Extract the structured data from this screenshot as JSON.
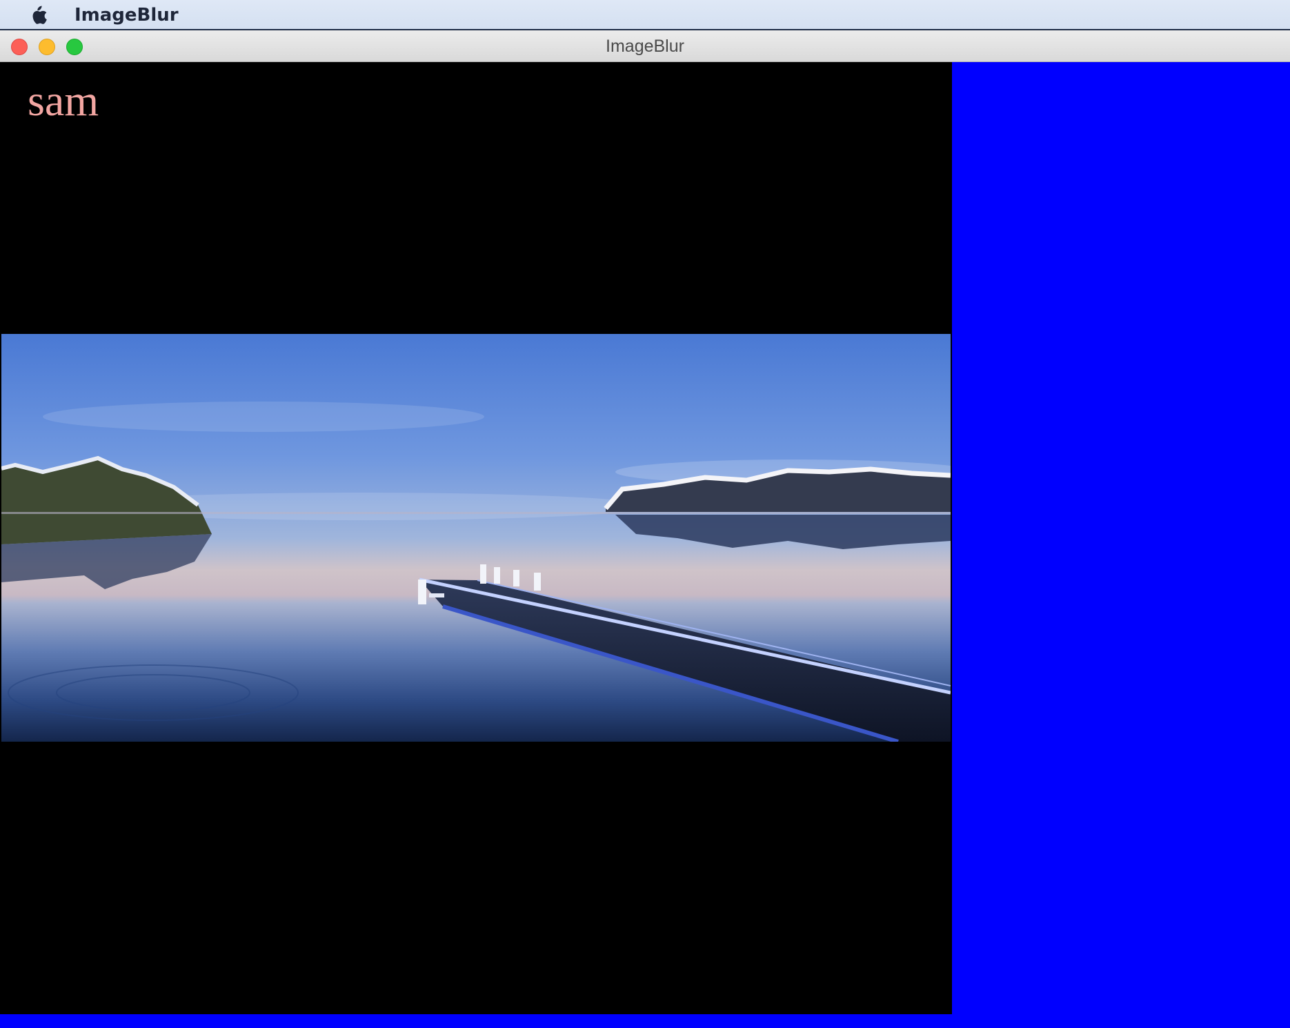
{
  "menubar": {
    "apple_icon": "apple-icon",
    "app_name": "ImageBlur"
  },
  "window": {
    "title": "ImageBlur",
    "controls": [
      "close-button",
      "minimize-button",
      "zoom-button"
    ]
  },
  "canvas": {
    "label": "sam",
    "label_color": "#f2a6a2",
    "background_left": "#000000",
    "background_right": "#0000ff"
  },
  "image": {
    "description_icon": "lake-dock-embossed-photo"
  }
}
